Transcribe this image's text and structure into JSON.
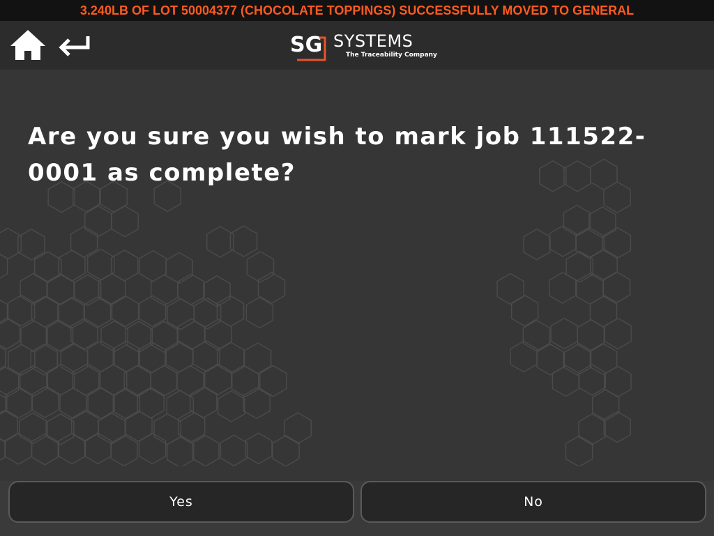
{
  "status_banner": {
    "message": "3.240LB OF LOT 50004377 (CHOCOLATE TOPPINGS) SUCCESSFULLY MOVED TO GENERAL",
    "color": "#ff5a1f"
  },
  "header": {
    "home_icon": "home-icon",
    "back_icon": "back-arrow-icon",
    "logo": {
      "mark": "SG",
      "name": "SYSTEMS",
      "tagline": "The Traceability Company",
      "accent_color": "#e8542a"
    }
  },
  "dialog": {
    "question": "Are you sure you wish to mark job 111522-0001 as complete?"
  },
  "actions": {
    "yes_label": "Yes",
    "no_label": "No"
  }
}
